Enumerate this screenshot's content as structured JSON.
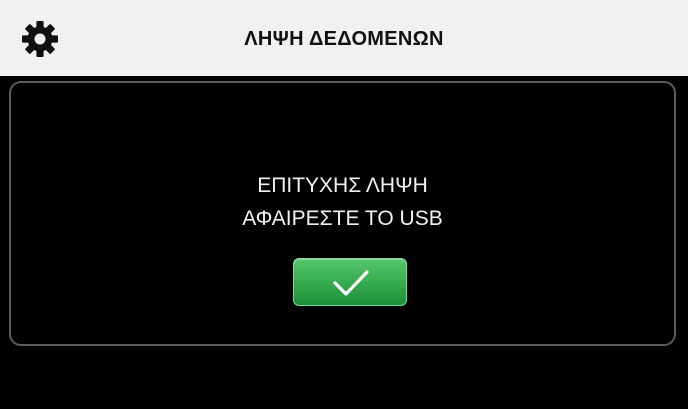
{
  "header": {
    "title": "ΛΗΨΗ ΔΕΔΟΜΕΝΩΝ",
    "settings_icon": "gear-icon"
  },
  "dialog": {
    "line1": "ΕΠΙΤΥΧΗΣ ΛΗΨΗ",
    "line2": "ΑΦΑΙΡΕΣΤΕ ΤΟ USB",
    "confirm_icon": "checkmark-icon"
  },
  "colors": {
    "header_bg": "#f1f1f1",
    "screen_bg": "#000000",
    "panel_border": "#5c5c5c",
    "confirm_green": "#37ac51",
    "text": "#f2f2f2"
  }
}
